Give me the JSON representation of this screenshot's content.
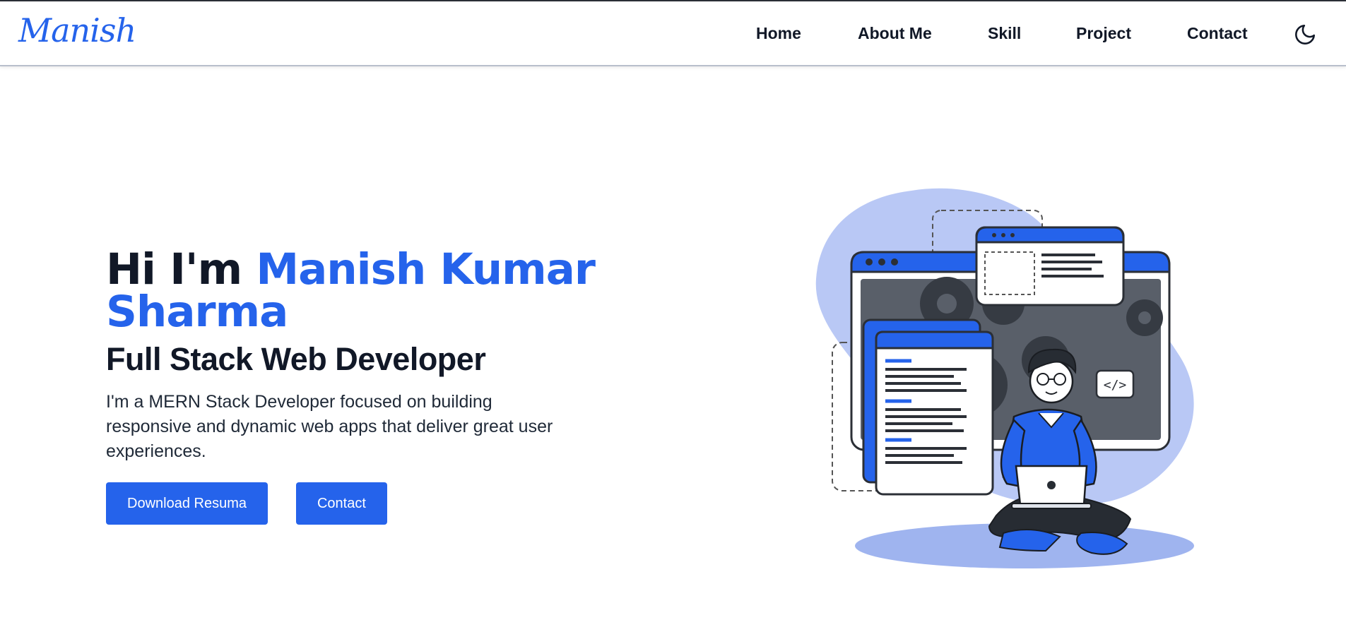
{
  "nav": {
    "logo": "Manish",
    "links": [
      "Home",
      "About Me",
      "Skill",
      "Project",
      "Contact"
    ],
    "theme_icon": "moon-icon"
  },
  "hero": {
    "greeting": "Hi I'm ",
    "name": "Manish Kumar Sharma",
    "role": "Full Stack Web Developer",
    "description": "I'm a MERN Stack Developer focused on building responsive and dynamic web apps that deliver great user experiences.",
    "buttons": {
      "download": "Download Resuma",
      "contact": "Contact"
    },
    "illustration_icon": "developer-laptop-illustration",
    "code_tag": "</>"
  },
  "colors": {
    "accent": "#2563eb",
    "light_accent": "#b9c8f5",
    "dark": "#111827"
  }
}
